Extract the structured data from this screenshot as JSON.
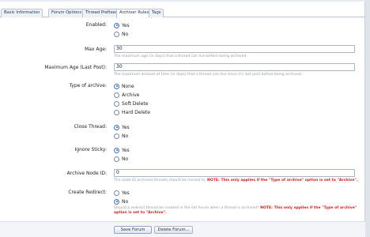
{
  "tabs": [
    {
      "label": "Basic Information",
      "active": false
    },
    {
      "label": "Forum Options",
      "active": false
    },
    {
      "label": "Thread Prefixes",
      "active": false
    },
    {
      "label": "Archiver Rules",
      "active": true
    },
    {
      "label": "Tags",
      "active": false
    }
  ],
  "fields": {
    "enabled": {
      "label": "Enabled:",
      "options": [
        "Yes",
        "No"
      ],
      "selected": "Yes"
    },
    "max_age": {
      "label": "Max Age:",
      "value": "30",
      "hint": "The maximum age (in days) that a thread can live before being archived."
    },
    "max_age_last_post": {
      "label": "Maximum Age (Last Post):",
      "value": "30",
      "hint": "The maximum amount of time (in days) that a thread can live since it's last post before being archived."
    },
    "type_of_archive": {
      "label": "Type of archive:",
      "options": [
        "None",
        "Archive",
        "Soft Delete",
        "Hard Delete"
      ],
      "selected": "None"
    },
    "close_thread": {
      "label": "Close Thread:",
      "options": [
        "Yes",
        "No"
      ],
      "selected": "Yes"
    },
    "ignore_sticky": {
      "label": "Ignore Sticky:",
      "options": [
        "Yes",
        "No"
      ],
      "selected": "Yes"
    },
    "archive_node_id": {
      "label": "Archive Node ID:",
      "value": "0",
      "hint": "The node ID archived threads should be moved to.",
      "note": "NOTE: This only applies if the \"Type of archive\" option is set to \"Archive\"."
    },
    "create_redirect": {
      "label": "Create Redirect:",
      "options": [
        "Yes",
        "No"
      ],
      "selected": "No",
      "hint": "Should a redirect thread be created in the old forum when a thread is archived?",
      "note_line1": "NOTE: This only applies if the \"Type of archive\"",
      "note_line2": "option is set to \"Archive\"."
    }
  },
  "buttons": {
    "save": "Save Forum",
    "delete": "Delete Forum..."
  }
}
